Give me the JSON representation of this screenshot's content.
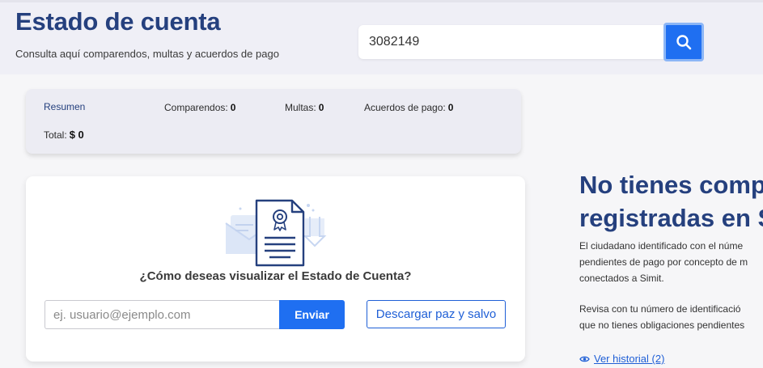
{
  "header": {
    "title": "Estado de cuenta",
    "subtitle": "Consulta aquí comparendos, multas y acuerdos de pago",
    "search_value": "3082149",
    "search_icon": "search-icon"
  },
  "summary": {
    "resumen_label": "Resumen",
    "comparendos_label": "Comparendos:",
    "comparendos_value": "0",
    "multas_label": "Multas:",
    "multas_value": "0",
    "acuerdos_label": "Acuerdos de pago:",
    "acuerdos_value": "0",
    "total_label": "Total:",
    "total_value": "$ 0"
  },
  "statement": {
    "illustration_icon": "certificate-document-icon",
    "question": "¿Cómo deseas visualizar el Estado de Cuenta?",
    "email_placeholder": "ej. usuario@ejemplo.com",
    "send_label": "Enviar",
    "download_label": "Descargar paz y salvo"
  },
  "empty_state": {
    "heading_line1": "No tienes comp",
    "heading_line2": "registradas en S",
    "paragraph1": [
      "El ciudadano identificado con el núme",
      "pendientes de pago por concepto de m",
      "conectados a Simit."
    ],
    "paragraph2": [
      "Revisa con tu número de identificació",
      "que no tienes obligaciones pendientes"
    ],
    "history_icon": "eye-icon",
    "history_label": "Ver historial (2)"
  },
  "colors": {
    "brand_navy": "#25407e",
    "primary_blue": "#1f6ff1",
    "header_bg": "#efeff6"
  }
}
